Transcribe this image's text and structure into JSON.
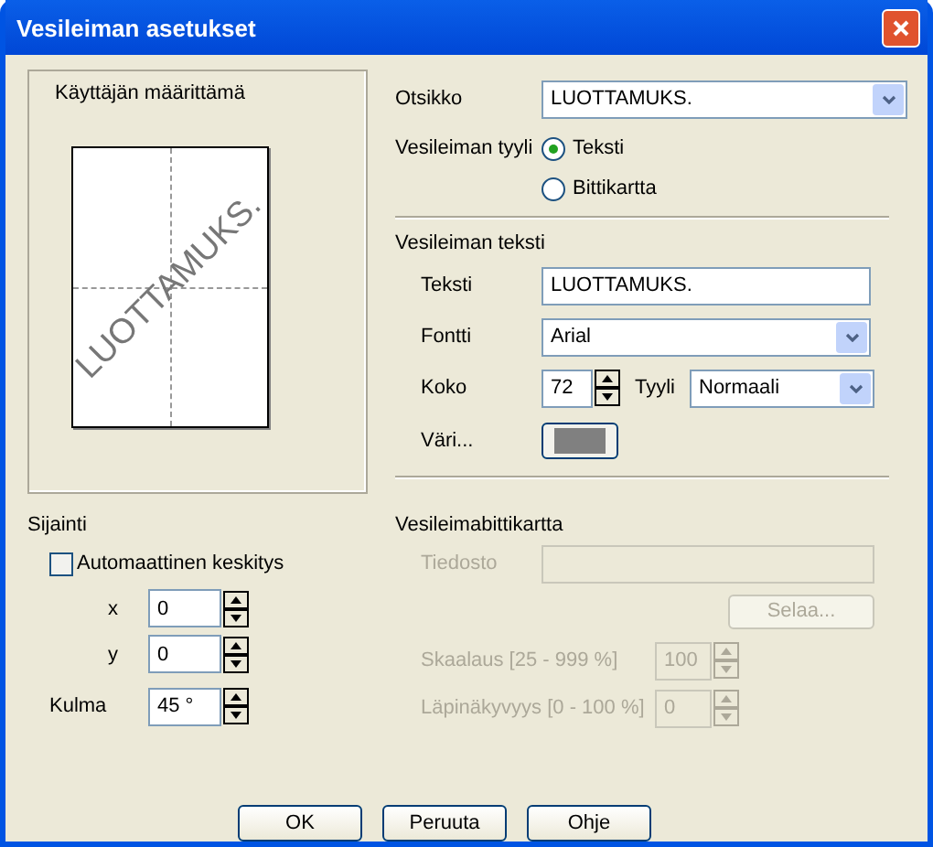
{
  "window": {
    "title": "Vesileiman asetukset"
  },
  "preview": {
    "label": "Käyttäjän määrittämä",
    "watermark_text": "LUOTTAMUKS."
  },
  "title_field": {
    "label": "Otsikko",
    "value": "LUOTTAMUKS."
  },
  "style": {
    "label": "Vesileiman tyyli",
    "options": [
      {
        "label": "Teksti",
        "selected": true
      },
      {
        "label": "Bittikartta",
        "selected": false
      }
    ]
  },
  "text_section": {
    "heading": "Vesileiman teksti",
    "text": {
      "label": "Teksti",
      "value": "LUOTTAMUKS."
    },
    "font": {
      "label": "Fontti",
      "value": "Arial"
    },
    "size": {
      "label": "Koko",
      "value": "72"
    },
    "font_style": {
      "label": "Tyyli",
      "value": "Normaali"
    },
    "color": {
      "label": "Väri...",
      "color": "#808080"
    }
  },
  "position": {
    "heading": "Sijainti",
    "auto_center": {
      "label": "Automaattinen keskitys",
      "checked": false
    },
    "x": {
      "label": "x",
      "value": "0"
    },
    "y": {
      "label": "y",
      "value": "0"
    },
    "angle": {
      "label": "Kulma",
      "value": "45 °"
    }
  },
  "bitmap_section": {
    "heading": "Vesileimabittikartta",
    "disabled": true,
    "file": {
      "label": "Tiedosto"
    },
    "browse_button": "Selaa...",
    "scale": {
      "label": "Skaalaus [25 - 999 %]",
      "value": "100"
    },
    "transparency": {
      "label": "Läpinäkyvyys [0 - 100 %]",
      "value": "0"
    }
  },
  "buttons": [
    "OK",
    "Peruuta",
    "Ohje"
  ]
}
